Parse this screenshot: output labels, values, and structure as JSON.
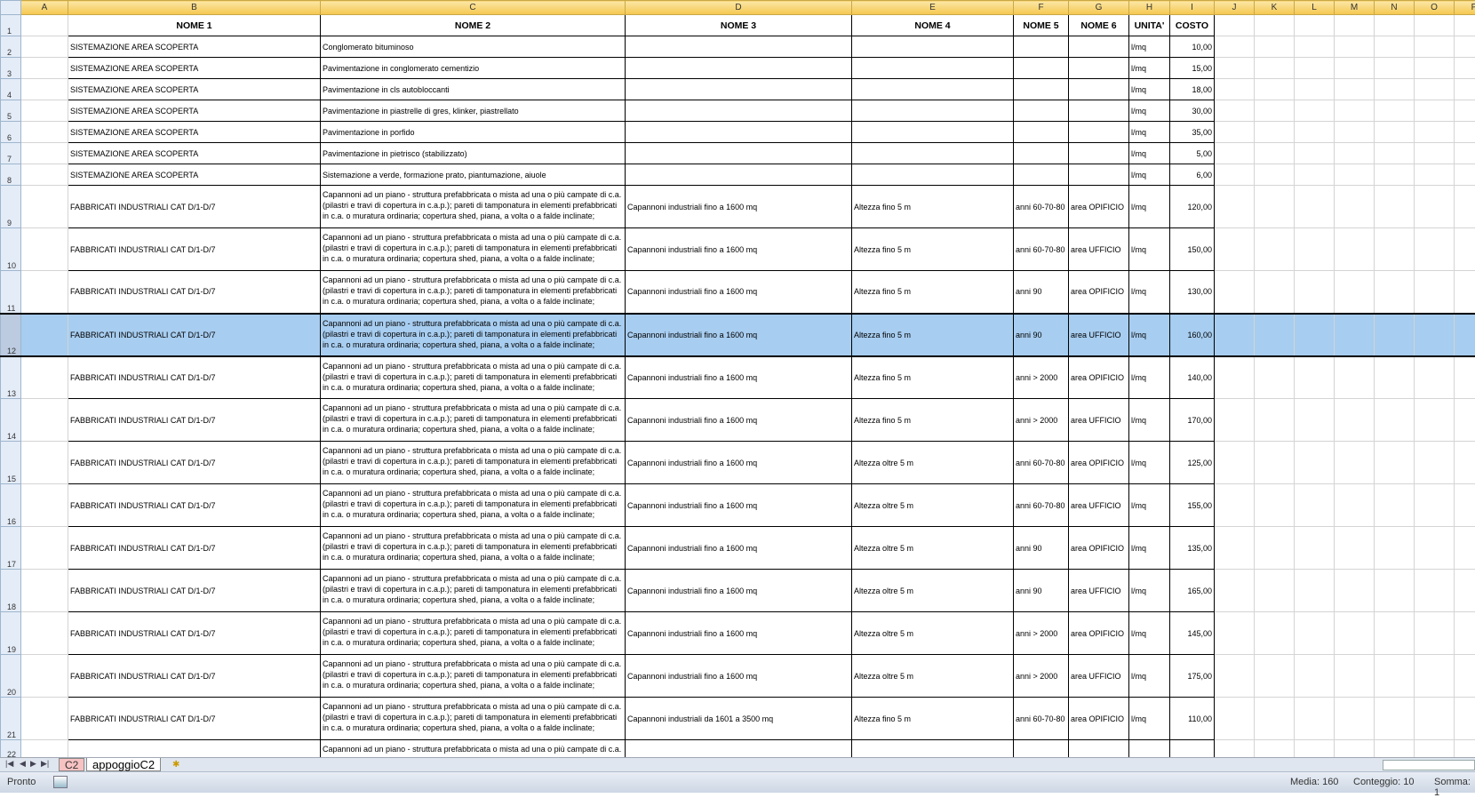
{
  "columns": [
    "A",
    "B",
    "C",
    "D",
    "E",
    "F",
    "G",
    "H",
    "I",
    "J",
    "K",
    "L",
    "M",
    "N",
    "O",
    "P"
  ],
  "headers": [
    "",
    "NOME 1",
    "NOME 2",
    "NOME 3",
    "NOME 4",
    "NOME 5",
    "NOME 6",
    "UNITA'",
    "COSTO"
  ],
  "rows": [
    [
      "",
      "SISTEMAZIONE AREA SCOPERTA",
      "Conglomerato bituminoso",
      "",
      "",
      "",
      "",
      "l/mq",
      "10,00"
    ],
    [
      "",
      "SISTEMAZIONE AREA SCOPERTA",
      "Pavimentazione in conglomerato cementizio",
      "",
      "",
      "",
      "",
      "l/mq",
      "15,00"
    ],
    [
      "",
      "SISTEMAZIONE AREA SCOPERTA",
      "Pavimentazione in cls autobloccanti",
      "",
      "",
      "",
      "",
      "l/mq",
      "18,00"
    ],
    [
      "",
      "SISTEMAZIONE AREA SCOPERTA",
      "Pavimentazione in piastrelle di gres, klinker, piastrellato",
      "",
      "",
      "",
      "",
      "l/mq",
      "30,00"
    ],
    [
      "",
      "SISTEMAZIONE AREA SCOPERTA",
      "Pavimentazione in porfido",
      "",
      "",
      "",
      "",
      "l/mq",
      "35,00"
    ],
    [
      "",
      "SISTEMAZIONE AREA SCOPERTA",
      "Pavimentazione in pietrisco (stabilizzato)",
      "",
      "",
      "",
      "",
      "l/mq",
      "5,00"
    ],
    [
      "",
      "SISTEMAZIONE AREA SCOPERTA",
      "Sistemazione a verde, formazione prato, piantumazione, aiuole",
      "",
      "",
      "",
      "",
      "l/mq",
      "6,00"
    ],
    [
      "",
      "FABBRICATI INDUSTRIALI CAT D/1-D/7",
      "Capannoni ad un piano - struttura prefabbricata o mista ad una o più campate di c.a. (pilastri e travi di copertura in c.a.p.); pareti di tamponatura in elementi prefabbricati in c.a. o muratura ordinaria; copertura shed, piana, a volta o a falde inclinate;",
      "Capannoni industriali fino a 1600 mq",
      "Altezza fino 5 m",
      "anni 60-70-80",
      "area OPIFICIO",
      "l/mq",
      "120,00"
    ],
    [
      "",
      "FABBRICATI INDUSTRIALI CAT D/1-D/7",
      "Capannoni ad un piano - struttura prefabbricata o mista ad una o più campate di c.a. (pilastri e travi di copertura in c.a.p.); pareti di tamponatura in elementi prefabbricati in c.a. o muratura ordinaria; copertura shed, piana, a volta o a falde inclinate;",
      "Capannoni industriali fino a 1600 mq",
      "Altezza fino 5 m",
      "anni 60-70-80",
      "area UFFICIO",
      "l/mq",
      "150,00"
    ],
    [
      "",
      "FABBRICATI INDUSTRIALI CAT D/1-D/7",
      "Capannoni ad un piano - struttura prefabbricata o mista ad una o più campate di c.a. (pilastri e travi di copertura in c.a.p.); pareti di tamponatura in elementi prefabbricati in c.a. o muratura ordinaria; copertura shed, piana, a volta o a falde inclinate;",
      "Capannoni industriali fino a 1600 mq",
      "Altezza fino 5 m",
      "anni 90",
      "area OPIFICIO",
      "l/mq",
      "130,00"
    ],
    [
      "",
      "FABBRICATI INDUSTRIALI CAT D/1-D/7",
      "Capannoni ad un piano - struttura prefabbricata o mista ad una o più campate di c.a. (pilastri e travi di copertura in c.a.p.); pareti di tamponatura in elementi prefabbricati in c.a. o muratura ordinaria; copertura shed, piana, a volta o a falde inclinate;",
      "Capannoni industriali fino a 1600 mq",
      "Altezza fino 5 m",
      "anni 90",
      "area UFFICIO",
      "l/mq",
      "160,00"
    ],
    [
      "",
      "FABBRICATI INDUSTRIALI CAT D/1-D/7",
      "Capannoni ad un piano - struttura prefabbricata o mista ad una o più campate di c.a. (pilastri e travi di copertura in c.a.p.); pareti di tamponatura in elementi prefabbricati in c.a. o muratura ordinaria; copertura shed, piana, a volta o a falde inclinate;",
      "Capannoni industriali fino a 1600 mq",
      "Altezza fino 5 m",
      "anni > 2000",
      "area OPIFICIO",
      "l/mq",
      "140,00"
    ],
    [
      "",
      "FABBRICATI INDUSTRIALI CAT D/1-D/7",
      "Capannoni ad un piano - struttura prefabbricata o mista ad una o più campate di c.a. (pilastri e travi di copertura in c.a.p.); pareti di tamponatura in elementi prefabbricati in c.a. o muratura ordinaria; copertura shed, piana, a volta o a falde inclinate;",
      "Capannoni industriali fino a 1600 mq",
      "Altezza fino 5 m",
      "anni > 2000",
      "area UFFICIO",
      "l/mq",
      "170,00"
    ],
    [
      "",
      "FABBRICATI INDUSTRIALI CAT D/1-D/7",
      "Capannoni ad un piano - struttura prefabbricata o mista ad una o più campate di c.a. (pilastri e travi di copertura in c.a.p.); pareti di tamponatura in elementi prefabbricati in c.a. o muratura ordinaria; copertura shed, piana, a volta o a falde inclinate;",
      "Capannoni industriali fino a 1600 mq",
      "Altezza oltre 5 m",
      "anni 60-70-80",
      "area OPIFICIO",
      "l/mq",
      "125,00"
    ],
    [
      "",
      "FABBRICATI INDUSTRIALI CAT D/1-D/7",
      "Capannoni ad un piano - struttura prefabbricata o mista ad una o più campate di c.a. (pilastri e travi di copertura in c.a.p.); pareti di tamponatura in elementi prefabbricati in c.a. o muratura ordinaria; copertura shed, piana, a volta o a falde inclinate;",
      "Capannoni industriali fino a 1600 mq",
      "Altezza oltre 5 m",
      "anni 60-70-80",
      "area UFFICIO",
      "l/mq",
      "155,00"
    ],
    [
      "",
      "FABBRICATI INDUSTRIALI CAT D/1-D/7",
      "Capannoni ad un piano - struttura prefabbricata o mista ad una o più campate di c.a. (pilastri e travi di copertura in c.a.p.); pareti di tamponatura in elementi prefabbricati in c.a. o muratura ordinaria; copertura shed, piana, a volta o a falde inclinate;",
      "Capannoni industriali fino a 1600 mq",
      "Altezza oltre 5 m",
      "anni 90",
      "area OPIFICIO",
      "l/mq",
      "135,00"
    ],
    [
      "",
      "FABBRICATI INDUSTRIALI CAT D/1-D/7",
      "Capannoni ad un piano - struttura prefabbricata o mista ad una o più campate di c.a. (pilastri e travi di copertura in c.a.p.); pareti di tamponatura in elementi prefabbricati in c.a. o muratura ordinaria; copertura shed, piana, a volta o a falde inclinate;",
      "Capannoni industriali fino a 1600 mq",
      "Altezza oltre 5 m",
      "anni 90",
      "area UFFICIO",
      "l/mq",
      "165,00"
    ],
    [
      "",
      "FABBRICATI INDUSTRIALI CAT D/1-D/7",
      "Capannoni ad un piano - struttura prefabbricata o mista ad una o più campate di c.a. (pilastri e travi di copertura in c.a.p.); pareti di tamponatura in elementi prefabbricati in c.a. o muratura ordinaria; copertura shed, piana, a volta o a falde inclinate;",
      "Capannoni industriali fino a 1600 mq",
      "Altezza oltre 5 m",
      "anni > 2000",
      "area OPIFICIO",
      "l/mq",
      "145,00"
    ],
    [
      "",
      "FABBRICATI INDUSTRIALI CAT D/1-D/7",
      "Capannoni ad un piano - struttura prefabbricata o mista ad una o più campate di c.a. (pilastri e travi di copertura in c.a.p.); pareti di tamponatura in elementi prefabbricati in c.a. o muratura ordinaria; copertura shed, piana, a volta o a falde inclinate;",
      "Capannoni industriali fino a 1600 mq",
      "Altezza oltre 5 m",
      "anni > 2000",
      "area UFFICIO",
      "l/mq",
      "175,00"
    ],
    [
      "",
      "FABBRICATI INDUSTRIALI CAT D/1-D/7",
      "Capannoni ad un piano - struttura prefabbricata o mista ad una o più campate di c.a. (pilastri e travi di copertura in c.a.p.); pareti di tamponatura in elementi prefabbricati in c.a. o muratura ordinaria; copertura shed, piana, a volta o a falde inclinate;",
      "Capannoni industriali da 1601 a 3500 mq",
      "Altezza fino 5 m",
      "anni 60-70-80",
      "area OPIFICIO",
      "l/mq",
      "110,00"
    ],
    [
      "",
      "",
      "Capannoni ad un piano - struttura prefabbricata o mista ad una o più campate di c.a.",
      "",
      "",
      "",
      "",
      "",
      ""
    ]
  ],
  "selected_row": 12,
  "sheet_tabs": [
    "C2",
    "appoggioC2"
  ],
  "status": {
    "ready": "Pronto",
    "average": "Media: 160",
    "count": "Conteggio: 10",
    "sum": "Somma: 1"
  },
  "colors": {
    "selection": "#a7cdf0",
    "header_highlight": "#f5c74f"
  }
}
